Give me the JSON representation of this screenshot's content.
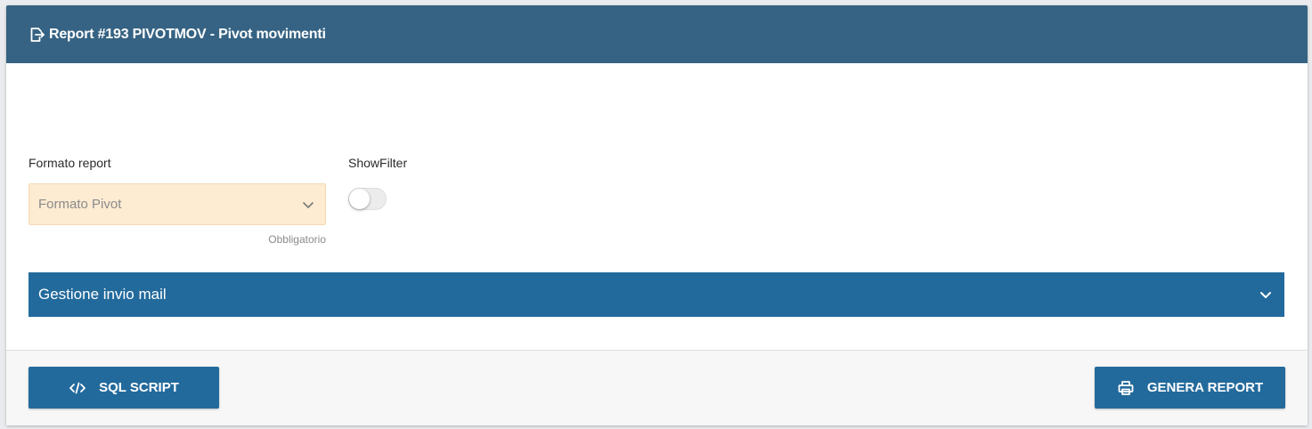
{
  "header": {
    "title": "Report #193 PIVOTMOV - Pivot movimenti",
    "icon": "export-file-icon"
  },
  "form": {
    "formato_label": "Formato report",
    "formato_value": "Formato Pivot",
    "formato_hint": "Obbligatorio",
    "showfilter_label": "ShowFilter",
    "showfilter_on": false
  },
  "accordion": {
    "label": "Gestione invio mail",
    "expanded": false
  },
  "footer": {
    "sql_label": "SQL SCRIPT",
    "sql_icon": "code-icon",
    "genera_label": "GENERA REPORT",
    "genera_icon": "printer-icon"
  },
  "colors": {
    "header_bg": "#366383",
    "accent": "#236a9c",
    "required_field_bg": "#fdebd2"
  }
}
